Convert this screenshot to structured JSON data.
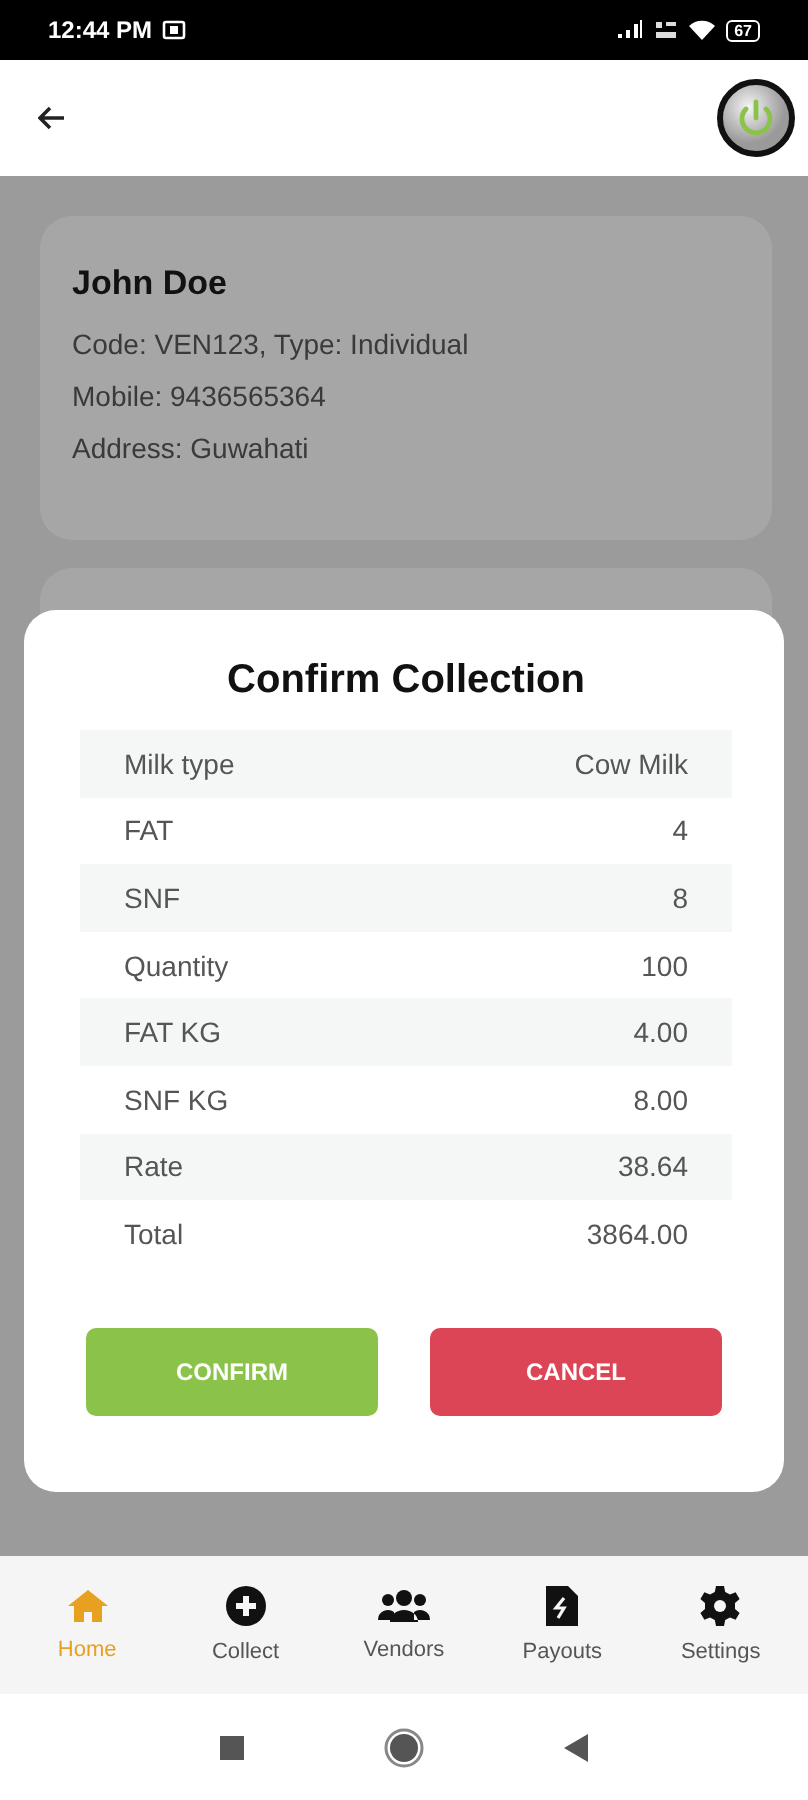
{
  "status_bar": {
    "time": "12:44 PM",
    "battery": "67"
  },
  "vendor": {
    "name": "John Doe",
    "code_line": "Code: VEN123, Type: Individual",
    "mobile_line": "Mobile: 9436565364",
    "address_line": "Address: Guwahati"
  },
  "dialog": {
    "title": "Confirm Collection",
    "rows": [
      {
        "label": "Milk type",
        "value": "Cow Milk"
      },
      {
        "label": "FAT",
        "value": "4"
      },
      {
        "label": "SNF",
        "value": "8"
      },
      {
        "label": "Quantity",
        "value": "100"
      },
      {
        "label": "FAT KG",
        "value": "4.00"
      },
      {
        "label": "SNF KG",
        "value": "8.00"
      },
      {
        "label": "Rate",
        "value": "38.64"
      },
      {
        "label": "Total",
        "value": "3864.00"
      }
    ],
    "buttons": [
      {
        "label": "CONFIRM",
        "kind": "confirm"
      },
      {
        "label": "CANCEL",
        "kind": "cancel"
      }
    ]
  },
  "bottom_nav": [
    {
      "label": "Home",
      "kind": "home",
      "selected": true
    },
    {
      "label": "Collect",
      "kind": "collect",
      "selected": false
    },
    {
      "label": "Vendors",
      "kind": "vendors",
      "selected": false
    },
    {
      "label": "Payouts",
      "kind": "payouts",
      "selected": false
    },
    {
      "label": "Settings",
      "kind": "settings",
      "selected": false
    }
  ]
}
